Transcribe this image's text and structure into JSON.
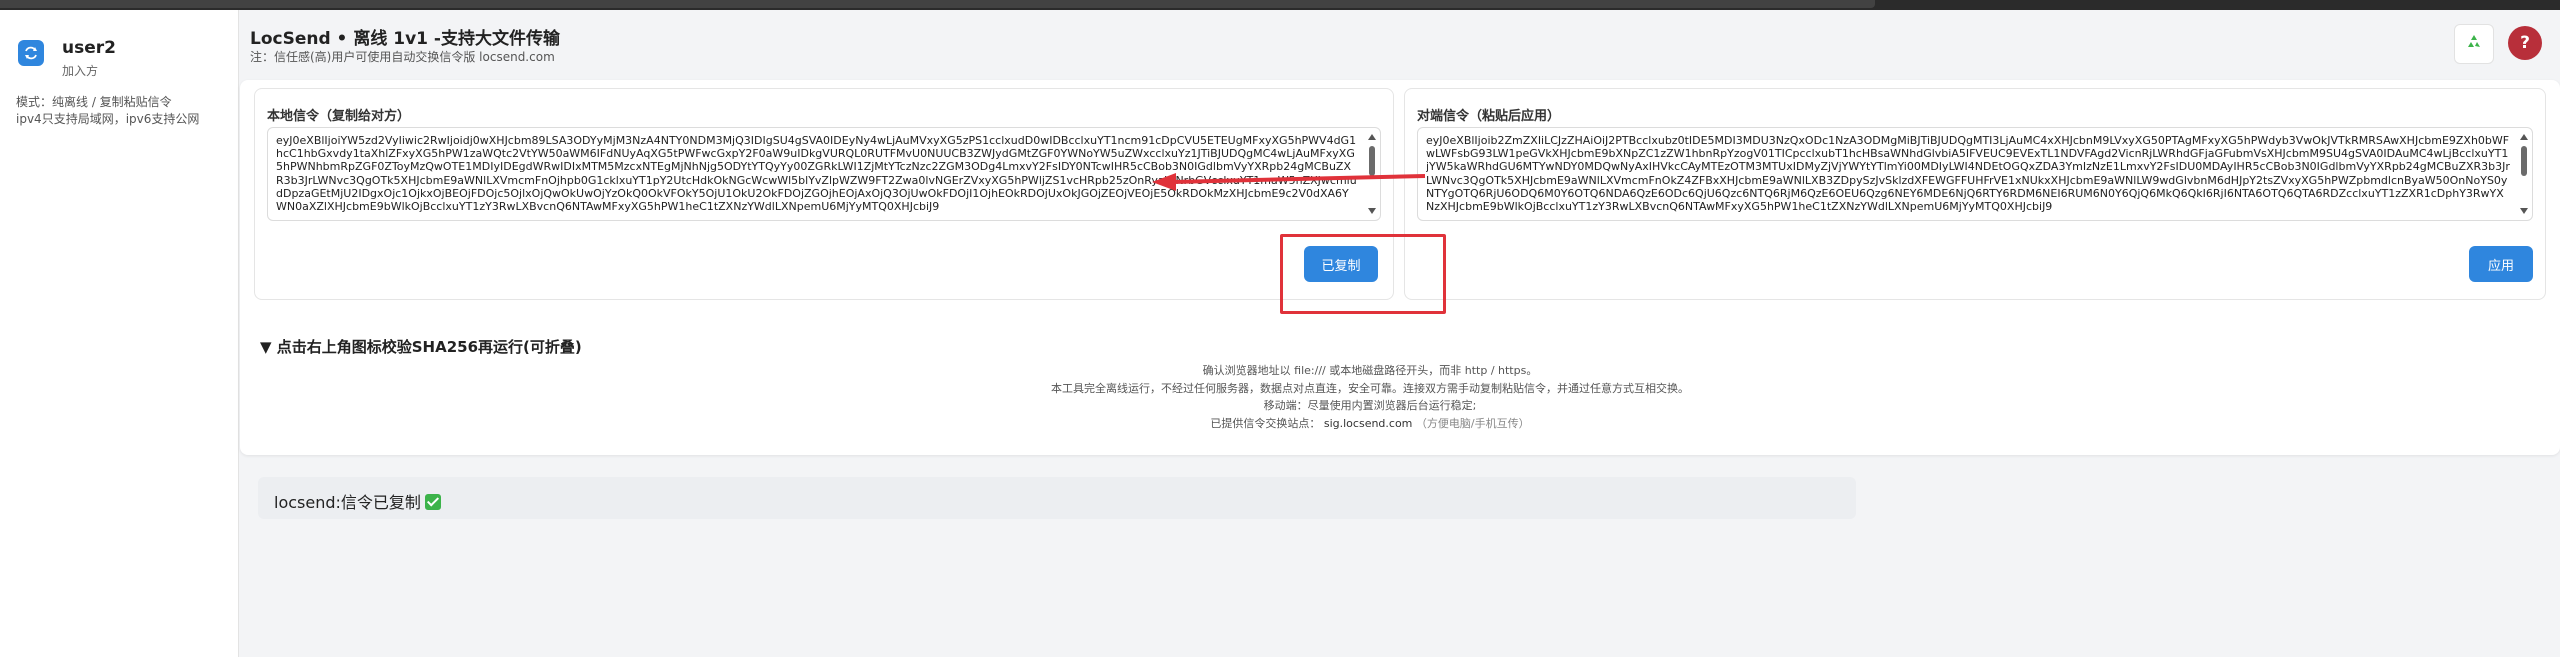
{
  "sidebar": {
    "user_name": "user2",
    "user_status": "加入方",
    "mode_line1": "模式：纯离线 / 复制粘贴信令",
    "mode_line2": "ipv4只支持局域网，ipv6支持公网"
  },
  "header": {
    "title": "LocSend • 离线 1v1 -支持大文件传输",
    "note": "注：信任感(高)用户可使用自动交换信令版 locsend.com"
  },
  "local_panel": {
    "label": "本地信令（复制给对方）",
    "signal": "eyJ0eXBlIjoiYW5zd2VyIiwic2RwIjoidj0wXHJcbm89LSA3ODYyMjM3NzA4NTY0NDM3MjQ3IDIgSU4gSVA0IDEyNy4wLjAuMVxyXG5zPS1cclxudD0wIDBcclxuYT1ncm91cDpCVU5ETEUgMFxyXG5hPWV4dG1hcC1hbGxvdy1taXhlZFxyXG5hPW1zaWQtc2VtYW50aWM6IFdNUyAqXG5tPWFwcGxpY2F0aW9uIDkgVURQL0RUTFMvU0NUUCB3ZWJydGMtZGF0YWNoYW5uZWxcclxuYz1JTiBJUDQgMC4wLjAuMFxyXG5hPWNhbmRpZGF0ZToyMzQwOTE1MDIyIDEgdWRwIDIxMTM5MzcxNTEgMjNhNjg5ODYtYTQyYy00ZGRkLWI1ZjMtYTczNzc2ZGM3ODg4LmxvY2FsIDY0NTcwIHR5cCBob3N0IGdlbmVyYXRpb24gMCBuZXR3b3JrLWNvc3QgOTk5XHJcbmE9aWNlLXVmcmFnOjhpb0G1cklxuYT1pY2UtcHdkOkNGcWcwWl5blYvZlpWZW9FT2Zwa0lvNGErZVxyXG5hPWljZS1vcHRpb25zOnRyaWNrbGVcclxuYT1maW5nZXJwcmludDpzaGEtMjU2IDgxOjc1OjkxOjBEOjFDOjc5OjlxOjQwOkUwOjYzOkQ0OkVFOkY5OjU1OkU2OkFDOjZGOjhEOjAxOjQ3OjUwOkFDOjI1OjhEOkRDOjUxOkJGOjZEOjVEOjE5OkRDOkMzXHJcbmE9c2V0dXA6YWN0aXZlXHJcbmE9bWlkOjBcclxuYT1zY3RwLXBvcnQ6NTAwMFxyXG5hPW1heC1tZXNzYWdlLXNpemU6MjYyMTQ0XHJcbiJ9"
  },
  "remote_panel": {
    "label": "对端信令（粘贴后应用）",
    "signal": "eyJ0eXBlIjoib2ZmZXIiLCJzZHAiOiJ2PTBcclxubz0tIDE5MDI3MDU3NzQxODc1NzA3ODMgMiBJTiBJUDQgMTI3LjAuMC4xXHJcbnM9LVxyXG50PTAgMFxyXG5hPWdyb3VwOkJVTkRMRSAwXHJcbmE9ZXh0bWFwLWFsbG93LW1peGVkXHJcbmE9bXNpZC1zZW1hbnRpYzogV01TICpcclxubT1hcHBsaWNhdGlvbiA5IFVEUC9EVExTL1NDVFAgd2VicnRjLWRhdGFjaGFubmVsXHJcbmM9SU4gSVA0IDAuMC4wLjBcclxuYT1jYW5kaWRhdGU6MTYwNDY0MDQwNyAxIHVkcCAyMTEzOTM3MTUxIDMyZjVjYWYtYTlmYi00MDIyLWI4NDEtOGQxZDA3YmIzNzE1LmxvY2FsIDU0MDAyIHR5cCBob3N0IGdlbmVyYXRpb24gMCBuZXR3b3JrLWNvc3QgOTk5XHJcbmE9aWNlLXVmcmFnOkZ4ZFBxXHJcbmE9aWNlLXB3ZDpySzJvSklzdXFEWGFFUHFrVE1xNUkxXHJcbmE9aWNlLW9wdGlvbnM6dHJpY2tsZVxyXG5hPWZpbmdlcnByaW50OnNoYS0yNTYgOTQ6RjU6ODQ6M0Y6OTQ6NDA6QzE6ODc6QjU6Qzc6NTQ6RjM6QzE6OEU6Qzg6NEY6MDE6NjQ6RTY6RDM6NEI6RUM6N0Y6QjQ6MkQ6QkI6RjI6NTA6OTQ6QTA6RDZcclxuYT1zZXR1cDphY3RwYXNzXHJcbmE9bWlkOjBcclxuYT1zY3RwLXBvcnQ6NTAwMFxyXG5hPW1heC1tZXNzYWdlLXNpemU6MjYyMTQ0XHJcbiJ9"
  },
  "buttons": {
    "copied": "已复制",
    "apply": "应用"
  },
  "collapsible": {
    "title": "▼ 点击右上角图标校验SHA256再运行(可折叠)"
  },
  "info": {
    "line1": "确认浏览器地址以 file:/// 或本地磁盘路径开头，而非 http / https。",
    "line2": "本工具完全离线运行，不经过任何服务器，数据点对点直连，安全可靠。连接双方需手动复制粘贴信令，并通过任意方式互相交换。",
    "line3": "移动端：尽量使用内置浏览器后台运行稳定;",
    "line4_prefix": "已提供信令交换站点：",
    "line4_site": "sig.locsend.com",
    "line4_hint": "（方便电脑/手机互传）"
  },
  "status": {
    "text": "locsend:信令已复制"
  },
  "colors": {
    "primary": "#2f86de",
    "highlight": "#e0323a",
    "help": "#b82f3a",
    "success": "#3cb34a"
  },
  "icons": {
    "brand": "sync-arrows-icon",
    "recycle": "recycle-icon",
    "help": "question-icon",
    "check": "check-icon"
  }
}
